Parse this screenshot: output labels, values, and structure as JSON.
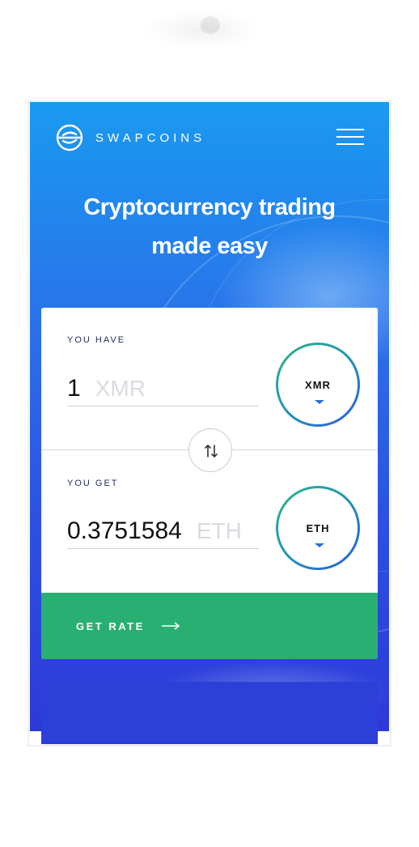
{
  "header": {
    "brand": "SWAPCOINS",
    "logo_icon": "swapcoins-logo-icon",
    "menu_icon": "hamburger-menu-icon"
  },
  "hero": {
    "headline_line1": "Cryptocurrency trading",
    "headline_line2": "made easy"
  },
  "exchange": {
    "have": {
      "label": "YOU HAVE",
      "amount": "1",
      "unit": "XMR",
      "coin": "XMR"
    },
    "get": {
      "label": "YOU GET",
      "amount": "0.3751584",
      "unit": "ETH",
      "coin": "ETH"
    },
    "swap_icon": "swap-arrows-icon",
    "submit_label": "GET RATE",
    "submit_icon": "arrow-right-icon"
  },
  "colors": {
    "hero_top": "#1a9af0",
    "hero_bottom": "#2d39d8",
    "button_green": "#2aaf73",
    "coin_ring_start": "#2fb486",
    "coin_ring_end": "#2c5be0"
  }
}
